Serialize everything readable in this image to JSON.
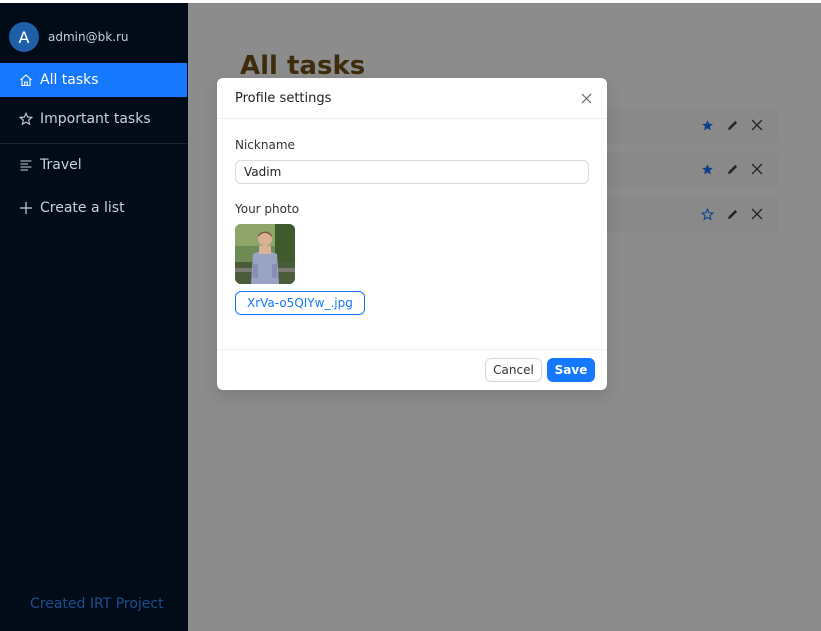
{
  "sidebar": {
    "user": {
      "avatar_letter": "A",
      "email": "admin@bk.ru"
    },
    "items": [
      {
        "label": "All tasks",
        "icon": "home-icon",
        "active": true
      },
      {
        "label": "Important tasks",
        "icon": "star-icon",
        "active": false
      },
      {
        "label": "Travel",
        "icon": "list-lines-icon",
        "active": false
      },
      {
        "label": "Create a list",
        "icon": "plus-icon",
        "active": false
      }
    ],
    "footer_link": "Created IRT Project"
  },
  "main": {
    "title": "All tasks",
    "tasks": [
      {
        "important": true
      },
      {
        "important": true
      },
      {
        "important": false
      }
    ]
  },
  "modal": {
    "title": "Profile settings",
    "nickname_label": "Nickname",
    "nickname_value": "Vadim",
    "photo_label": "Your photo",
    "file_name": "XrVa-o5QIYw_.jpg",
    "cancel_label": "Cancel",
    "save_label": "Save"
  },
  "colors": {
    "sidebar_bg": "#020b18",
    "accent": "#1677ff",
    "title_color": "#6f5216"
  }
}
